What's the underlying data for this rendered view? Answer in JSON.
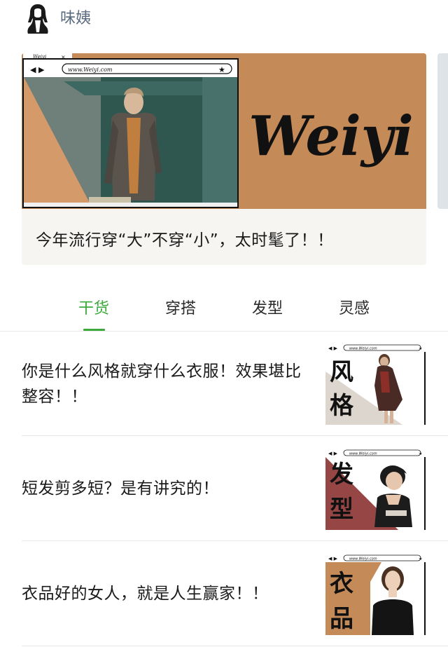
{
  "account": {
    "name": "味姨"
  },
  "banner": {
    "url": "www.Weiyi.com",
    "brand": "Weiyi",
    "caption": "今年流行穿“大”不穿“小”，太时髦了！！"
  },
  "tabs": [
    {
      "label": "干货",
      "active": true
    },
    {
      "label": "穿搭",
      "active": false
    },
    {
      "label": "发型",
      "active": false
    },
    {
      "label": "灵感",
      "active": false
    }
  ],
  "articles": [
    {
      "title": "你是什么风格就穿什么衣服！效果堪比整容！！",
      "thumb_url": "www.Weiyi.com",
      "thumb_tag": [
        "风",
        "格"
      ]
    },
    {
      "title": "短发剪多短？是有讲究的！",
      "thumb_url": "www.Weiyi.com",
      "thumb_tag": [
        "发",
        "型"
      ]
    },
    {
      "title": "衣品好的女人，就是人生赢家！！",
      "thumb_url": "www.Weiyi.com",
      "thumb_tag": [
        "衣",
        "品"
      ]
    }
  ],
  "colors": {
    "accent": "#3daa3d",
    "banner_bg": "#c48a57",
    "thumb_beige": "#ddd6cf",
    "thumb_red": "#974646",
    "thumb_tan": "#c48a57"
  }
}
